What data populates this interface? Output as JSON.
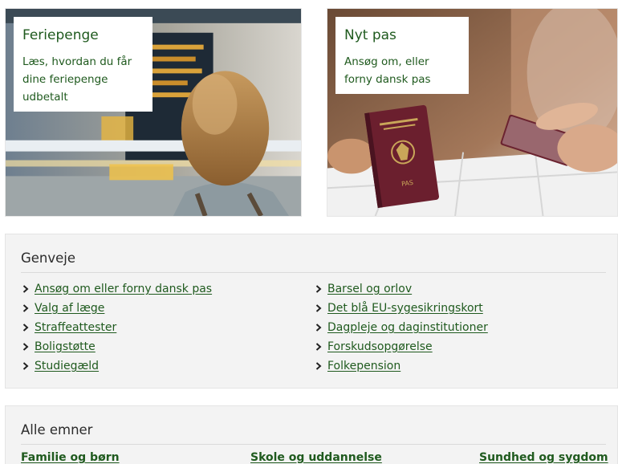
{
  "cards": [
    {
      "title": "Feriepenge",
      "text": "Læs, hvordan du får dine feriepenge udbetalt"
    },
    {
      "title": "Nyt pas",
      "text": "Ansøg om, eller forny dansk pas"
    }
  ],
  "shortcuts": {
    "title": "Genveje",
    "col1": [
      "Ansøg om eller forny dansk pas",
      "Valg af læge",
      "Straffeattester",
      "Boligstøtte",
      "Studiegæld"
    ],
    "col2": [
      "Barsel og orlov",
      "Det blå EU-sygesikringskort",
      "Dagpleje og daginstitutioner",
      "Forskudsopgørelse",
      "Folkepension"
    ]
  },
  "topics": {
    "title": "Alle emner",
    "items": [
      "Familie og børn",
      "Skole og uddannelse",
      "Sundhed og sygdom"
    ]
  },
  "passport_cover_text": "PAS"
}
